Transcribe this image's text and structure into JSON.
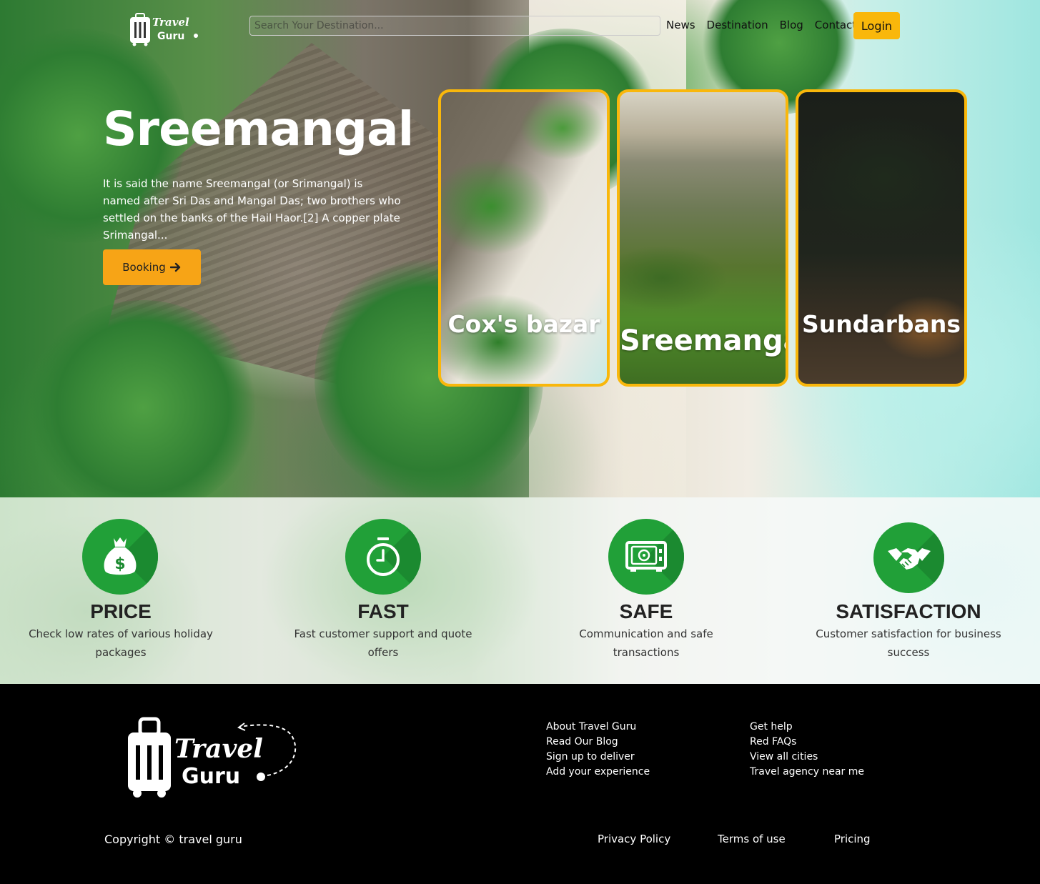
{
  "nav": {
    "logo_line1": "Travel",
    "logo_line2": "Guru",
    "search_placeholder": "Search Your Destination...",
    "links": [
      "News",
      "Destination",
      "Blog",
      "Contact"
    ],
    "login_label": "Login"
  },
  "hero": {
    "title": "Sreemangal",
    "description": "It is said the name Sreemangal (or Srimangal) is named after Sri Das and Mangal Das; two brothers who settled on the banks of the Hail Haor.[2] A copper plate Srimangal...",
    "booking_label": "Booking"
  },
  "cards": [
    {
      "name": "Cox's bazar"
    },
    {
      "name": "Sreemangal"
    },
    {
      "name": "Sundarbans"
    }
  ],
  "features": [
    {
      "title": "PRICE",
      "desc": "Check low rates of various holiday packages",
      "icon": "money-bag-icon"
    },
    {
      "title": "FAST",
      "desc": "Fast customer support and quote offers",
      "icon": "stopwatch-icon"
    },
    {
      "title": "SAFE",
      "desc": "Communication and safe transactions",
      "icon": "safe-icon"
    },
    {
      "title": "SATISFACTION",
      "desc": "Customer satisfaction for business success",
      "icon": "handshake-icon"
    }
  ],
  "footer": {
    "logo_line1": "Travel",
    "logo_line2": "Guru",
    "col1": [
      "About Travel Guru",
      "Read Our Blog",
      "Sign up to deliver",
      "Add your experience"
    ],
    "col2": [
      "Get help",
      "Red FAQs",
      "View all cities",
      "Travel agency near me"
    ],
    "copyright": "Copyright © travel guru",
    "bottom_links": [
      "Privacy Policy",
      "Terms of use",
      "Pricing"
    ]
  },
  "colors": {
    "accent": "#f9b70b",
    "booking": "#f7a416",
    "feature_green": "#21a038",
    "footer_bg": "#000000"
  }
}
